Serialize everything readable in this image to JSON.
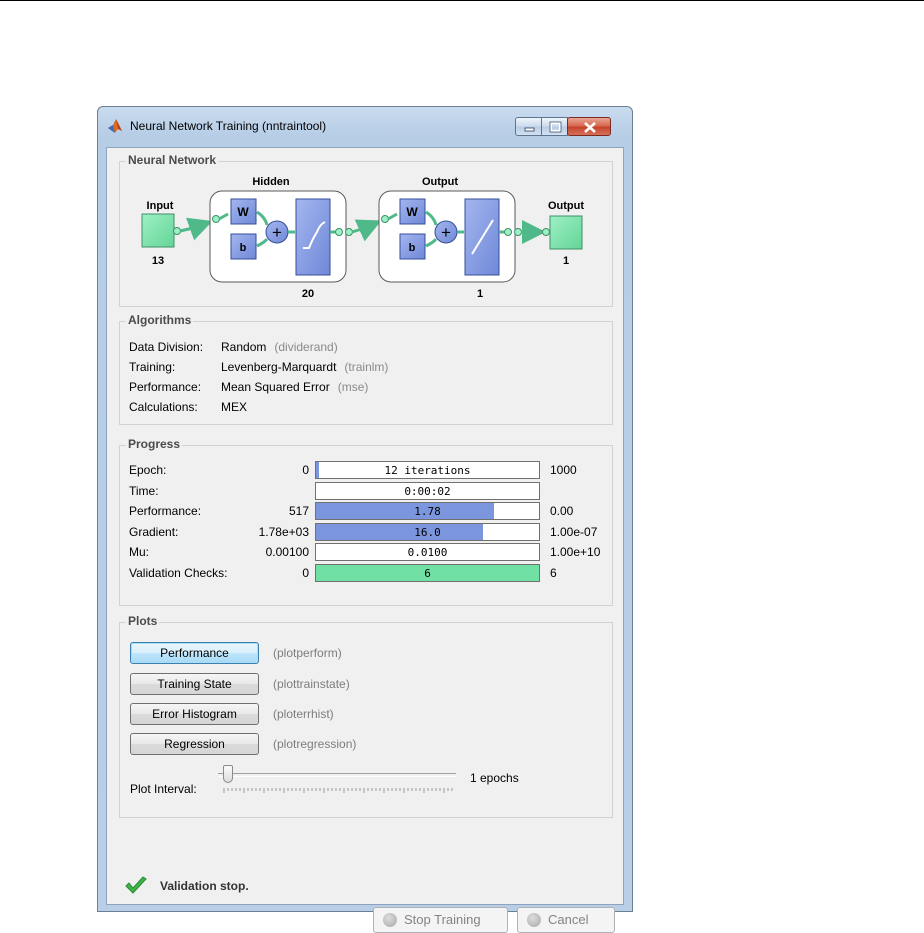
{
  "window": {
    "title": "Neural Network Training (nntraintool)"
  },
  "network": {
    "panel_title": "Neural Network",
    "input_label": "Input",
    "input_size": "13",
    "hidden_label": "Hidden",
    "hidden_size": "20",
    "output_layer_label": "Output",
    "output_layer_size": "1",
    "output_label": "Output",
    "output_size": "1",
    "weight_label": "W",
    "bias_label": "b",
    "sum_symbol": "+"
  },
  "algorithms": {
    "panel_title": "Algorithms",
    "rows": [
      {
        "label": "Data Division:",
        "value": "Random",
        "code": "(dividerand)"
      },
      {
        "label": "Training:",
        "value": "Levenberg-Marquardt",
        "code": "(trainlm)"
      },
      {
        "label": "Performance:",
        "value": "Mean Squared Error",
        "code": "(mse)"
      },
      {
        "label": "Calculations:",
        "value": "MEX",
        "code": ""
      }
    ]
  },
  "progress": {
    "panel_title": "Progress",
    "rows": [
      {
        "label": "Epoch:",
        "start": "0",
        "current": "12 iterations",
        "end": "1000",
        "fill": 0.012,
        "color": "#7b96dc"
      },
      {
        "label": "Time:",
        "start": "",
        "current": "0:00:02",
        "end": "",
        "fill": 0,
        "color": "#7b96dc"
      },
      {
        "label": "Performance:",
        "start": "517",
        "current": "1.78",
        "end": "0.00",
        "fill": 0.8,
        "color": "#7b96dc"
      },
      {
        "label": "Gradient:",
        "start": "1.78e+03",
        "current": "16.0",
        "end": "1.00e-07",
        "fill": 0.75,
        "color": "#7b96dc"
      },
      {
        "label": "Mu:",
        "start": "0.00100",
        "current": "0.0100",
        "end": "1.00e+10",
        "fill": 0,
        "color": "#7b96dc"
      },
      {
        "label": "Validation Checks:",
        "start": "0",
        "current": "6",
        "end": "6",
        "fill": 1.0,
        "color": "#71e0a4"
      }
    ]
  },
  "plots": {
    "panel_title": "Plots",
    "buttons": [
      {
        "label": "Performance",
        "code": "(plotperform)"
      },
      {
        "label": "Training State",
        "code": "(plottrainstate)"
      },
      {
        "label": "Error Histogram",
        "code": "(ploterrhist)"
      },
      {
        "label": "Regression",
        "code": "(plotregression)"
      }
    ],
    "interval_label": "Plot Interval:",
    "interval_value": "1 epochs",
    "slider_fraction": 0
  },
  "status": {
    "text": "Validation stop.",
    "icon": "checkmark-icon"
  },
  "footer": {
    "stop_label": "Stop Training",
    "cancel_label": "Cancel"
  }
}
